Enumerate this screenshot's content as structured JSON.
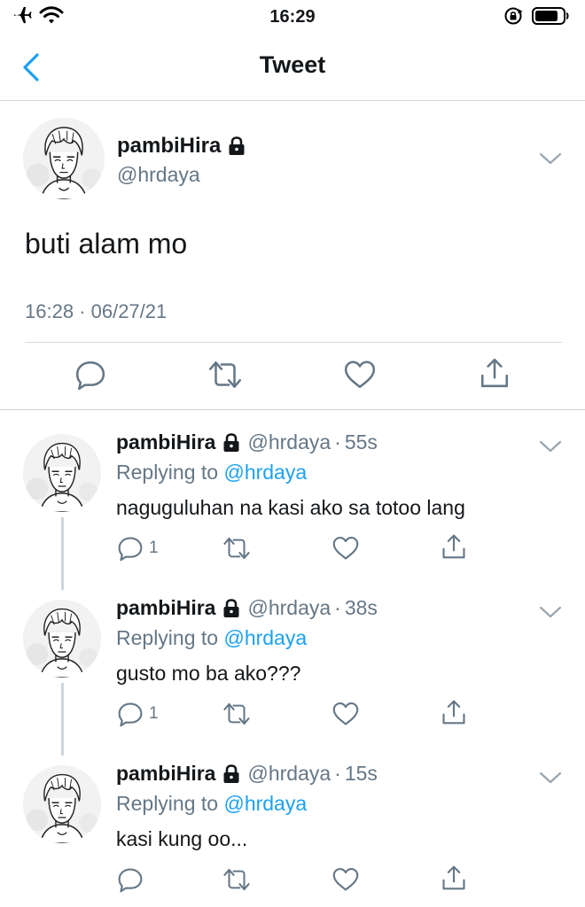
{
  "status_bar": {
    "time": "16:29",
    "icons": [
      "airplane-icon",
      "wifi-icon",
      "orientation-lock-icon",
      "battery-icon"
    ]
  },
  "nav": {
    "back_icon": "chevron-left-icon",
    "title": "Tweet"
  },
  "colors": {
    "accent": "#1da1f2",
    "secondary_text": "#657786",
    "text": "#14171a",
    "divider": "#d6d6d6"
  },
  "main_tweet": {
    "display_name": "pambiHira",
    "handle": "@hrdaya",
    "text": "buti alam mo",
    "timestamp": "16:28 · 06/27/21",
    "actions": [
      "reply-icon",
      "retweet-icon",
      "like-icon",
      "share-icon"
    ]
  },
  "replies": [
    {
      "display_name": "pambiHira",
      "handle": "@hrdaya",
      "separator": "·",
      "age": "55s",
      "replying_prefix": "Replying to",
      "replying_to": "@hrdaya",
      "text": "naguguluhan na kasi ako sa totoo lang",
      "reply_count": "1"
    },
    {
      "display_name": "pambiHira",
      "handle": "@hrdaya",
      "separator": "·",
      "age": "38s",
      "replying_prefix": "Replying to",
      "replying_to": "@hrdaya",
      "text": "gusto mo ba ako???",
      "reply_count": "1"
    },
    {
      "display_name": "pambiHira",
      "handle": "@hrdaya",
      "separator": "·",
      "age": "15s",
      "replying_prefix": "Replying to",
      "replying_to": "@hrdaya",
      "text": "kasi kung oo...",
      "reply_count": ""
    }
  ]
}
